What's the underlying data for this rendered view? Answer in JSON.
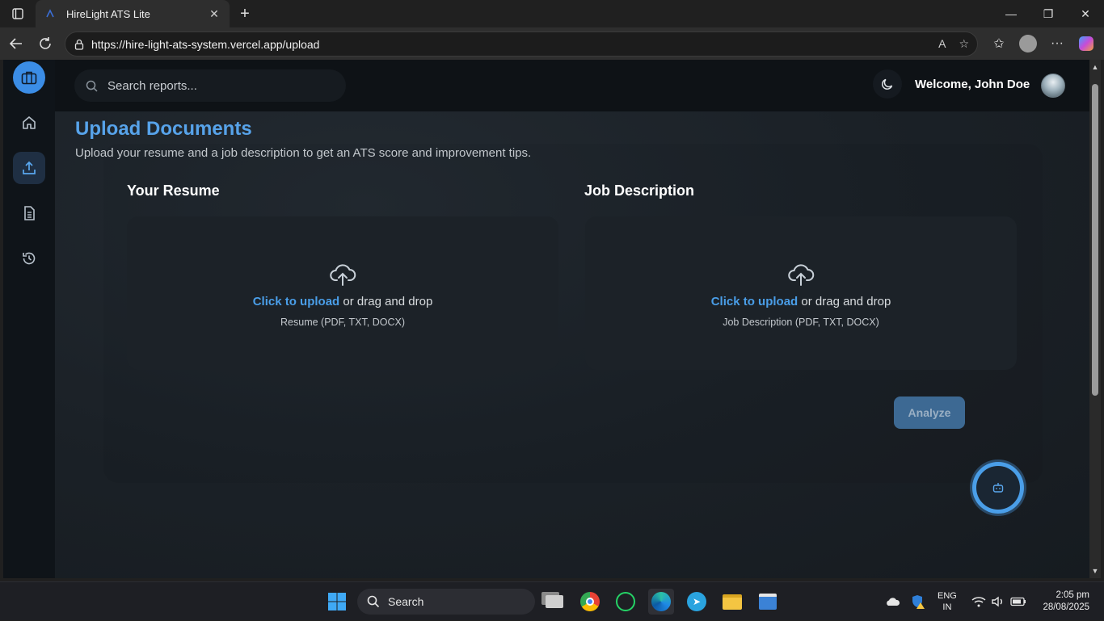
{
  "browser": {
    "tab_title": "HireLight ATS Lite",
    "url": "https://hire-light-ats-system.vercel.app/upload"
  },
  "header": {
    "search_placeholder": "Search reports...",
    "welcome": "Welcome, John Doe"
  },
  "page": {
    "title": "Upload Documents",
    "subtitle": "Upload your resume and a job description to get an ATS score and improvement tips."
  },
  "resume": {
    "heading": "Your Resume",
    "link": "Click to upload",
    "rest": " or drag and drop",
    "hint": "Resume (PDF, TXT, DOCX)"
  },
  "job": {
    "heading": "Job Description",
    "link": "Click to upload",
    "rest": " or drag and drop",
    "hint": "Job Description (PDF, TXT, DOCX)"
  },
  "actions": {
    "analyze": "Analyze"
  },
  "taskbar": {
    "search_label": "Search",
    "lang_top": "ENG",
    "lang_bottom": "IN",
    "time": "2:05 pm",
    "date": "28/08/2025"
  },
  "colors": {
    "accent": "#4a9ee8",
    "title": "#57a3ea",
    "analyze_bg": "#3d6993"
  }
}
